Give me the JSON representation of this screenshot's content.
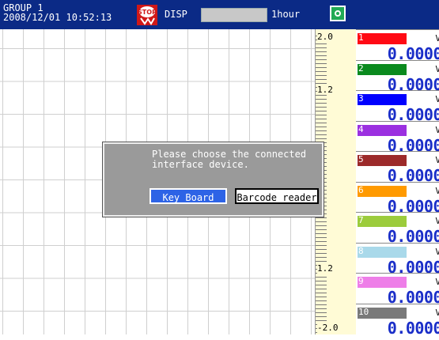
{
  "header": {
    "group": "GROUP 1",
    "datetime": "2008/12/01 10:52:13",
    "disp_label": "DISP",
    "time_span": "1hour"
  },
  "scale": {
    "labels": [
      "2.0",
      "1.2",
      "1.2",
      "-2.0"
    ]
  },
  "channels": [
    {
      "num": "1",
      "color": "#ff0a14",
      "unit": "V",
      "value": "0.0000"
    },
    {
      "num": "2",
      "color": "#0a8a1e",
      "unit": "V",
      "value": "0.0000"
    },
    {
      "num": "3",
      "color": "#0000ff",
      "unit": "V",
      "value": "0.0000"
    },
    {
      "num": "4",
      "color": "#9b30e0",
      "unit": "V",
      "value": "0.0000"
    },
    {
      "num": "5",
      "color": "#9c2a2a",
      "unit": "V",
      "value": "0.0000"
    },
    {
      "num": "6",
      "color": "#ff9a00",
      "unit": "V",
      "value": "0.0000"
    },
    {
      "num": "7",
      "color": "#9ccc3c",
      "unit": "V",
      "value": "0.0000"
    },
    {
      "num": "8",
      "color": "#a9d9ea",
      "unit": "V",
      "value": "0.0000"
    },
    {
      "num": "9",
      "color": "#ee7ee8",
      "unit": "V",
      "value": "0.0000"
    },
    {
      "num": "10",
      "color": "#7a7a7a",
      "unit": "V",
      "value": "0.0000"
    }
  ],
  "dialog": {
    "message": "Please choose the connected interface device.",
    "keyboard_label": "Key Board",
    "barcode_label": "Barcode reader"
  }
}
